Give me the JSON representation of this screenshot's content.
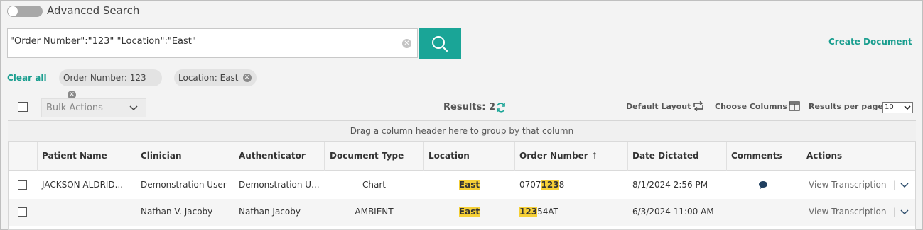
{
  "advanced_search": {
    "label": "Advanced Search",
    "enabled": false
  },
  "search": {
    "value": "\"Order Number\":\"123\" \"Location\":\"East\""
  },
  "create_document": "Create Document",
  "filters": {
    "clear_all": "Clear all",
    "chips": [
      "Order Number: 123",
      "Location: East"
    ]
  },
  "toolbar": {
    "bulk_actions": "Bulk Actions",
    "results": "Results: 2",
    "default_layout": "Default Layout",
    "choose_columns": "Choose Columns",
    "results_per_page": "Results per page",
    "results_per_page_value": "10"
  },
  "grid": {
    "group_hint": "Drag a column header here to group by that column",
    "columns": [
      "Patient Name",
      "Clinician",
      "Authenticator",
      "Document Type",
      "Location",
      "Order Number",
      "Date Dictated",
      "Comments",
      "Actions"
    ],
    "sort_indicator": "↑",
    "rows": [
      {
        "patient_name": "JACKSON ALDRID...",
        "clinician": "Demonstration User",
        "authenticator": "Demonstration U...",
        "document_type": "Chart",
        "location": "East",
        "order_number": {
          "pre": "0707",
          "match": "123",
          "post": "8"
        },
        "date_dictated": "8/1/2024 2:56 PM",
        "has_comment": true,
        "action": "View Transcription",
        "separator": "|"
      },
      {
        "patient_name": "",
        "clinician": "Nathan V. Jacoby",
        "authenticator": "Nathan Jacoby",
        "document_type": "AMBIENT",
        "location": "East",
        "order_number": {
          "pre": "",
          "match": "123",
          "post": "54AT"
        },
        "date_dictated": "6/3/2024 11:00 AM",
        "has_comment": false,
        "action": "View Transcription",
        "separator": "|"
      }
    ]
  },
  "colors": {
    "accent": "#1aa597",
    "highlight": "#f6d037",
    "comment_icon": "#1f3f5f"
  }
}
